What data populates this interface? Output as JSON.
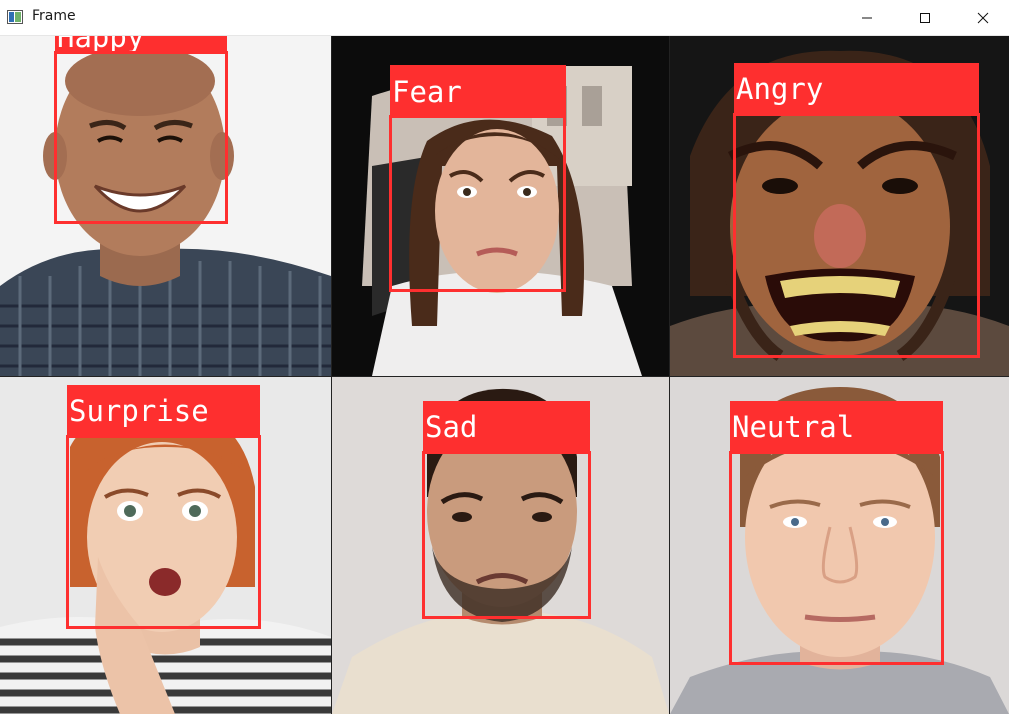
{
  "window": {
    "title": "Frame",
    "controls": {
      "minimize": "minimize",
      "maximize": "maximize",
      "close": "close"
    }
  },
  "detections": [
    {
      "label": "Happy"
    },
    {
      "label": "Fear"
    },
    {
      "label": "Angry"
    },
    {
      "label": "Surprise"
    },
    {
      "label": "Sad"
    },
    {
      "label": "Neutral"
    }
  ],
  "colors": {
    "box": "#fe2f2f",
    "label_text": "#ffffff"
  }
}
